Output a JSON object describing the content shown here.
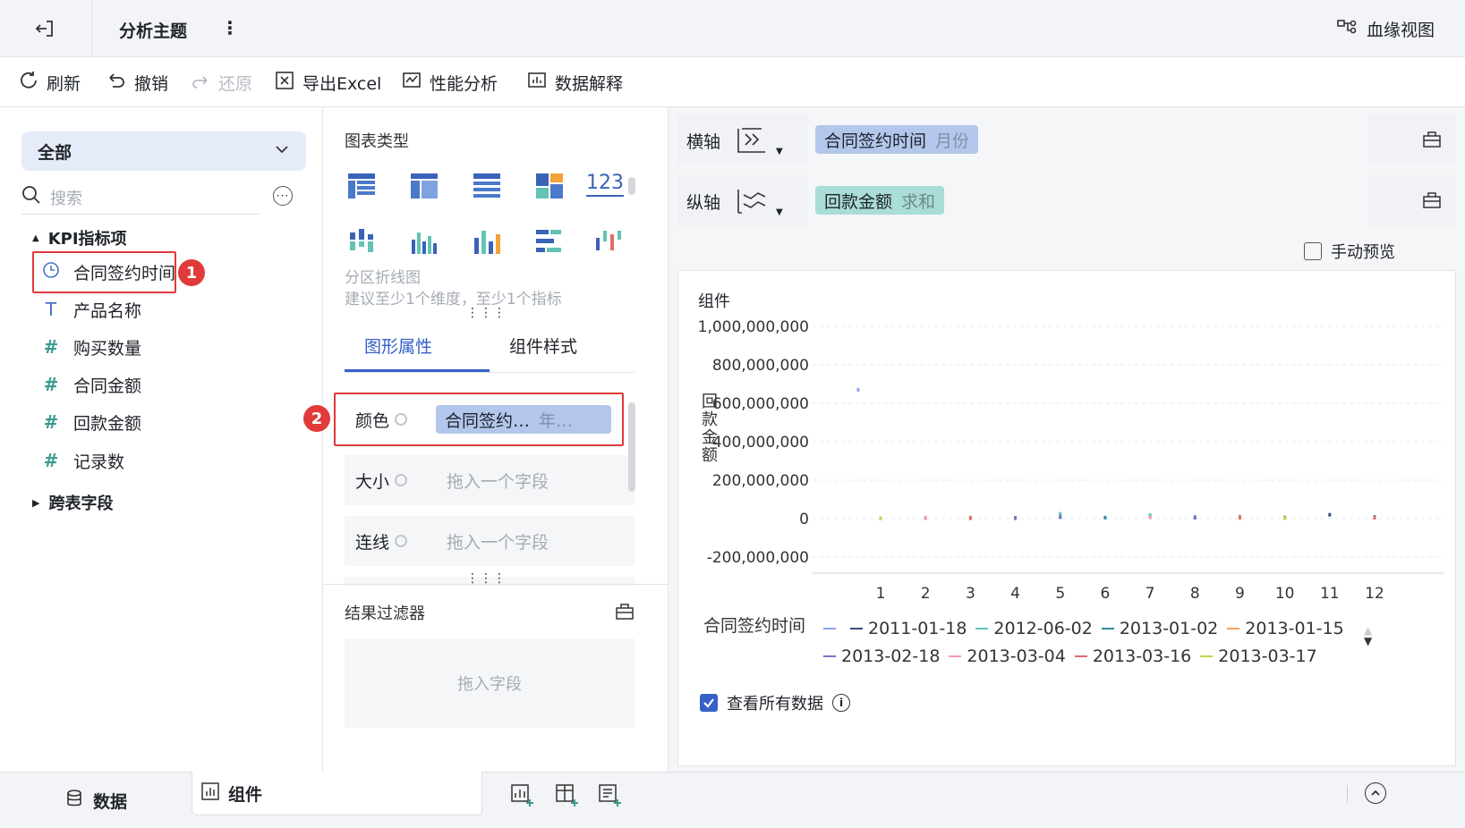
{
  "topbar": {
    "title": "分析主题",
    "more": "⋮",
    "lineage": "血缘视图"
  },
  "toolbar": {
    "refresh": "刷新",
    "undo": "撤销",
    "redo": "还原",
    "export": "导出Excel",
    "perf": "性能分析",
    "explain": "数据解释"
  },
  "left": {
    "dropdown": "全部",
    "search_placeholder": "搜索",
    "group1": "KPI指标项",
    "fields": [
      {
        "label": "合同签约时间",
        "icon": "clock-icon"
      },
      {
        "label": "产品名称",
        "icon": "text-type-icon"
      },
      {
        "label": "购买数量",
        "icon": "hash-icon"
      },
      {
        "label": "合同金额",
        "icon": "hash-icon"
      },
      {
        "label": "回款金额",
        "icon": "hash-icon"
      },
      {
        "label": "记录数",
        "icon": "hash-star-icon"
      }
    ],
    "group2": "跨表字段",
    "badge1": "1"
  },
  "mid": {
    "chart_type_title": "图表类型",
    "hint_title": "分区折线图",
    "hint_desc": "建议至少1个维度，至少1个指标",
    "tab_active": "图形属性",
    "tab_other": "组件样式",
    "badge2": "2",
    "color_label": "颜色",
    "color_chip_main": "合同签约…",
    "color_chip_sub": "年…",
    "size_label": "大小",
    "size_placeholder": "拖入一个字段",
    "line_label": "连线",
    "line_placeholder": "拖入一个字段",
    "filter_title": "结果过滤器",
    "filter_placeholder": "拖入字段",
    "kpi_text": "123"
  },
  "right": {
    "x_label": "横轴",
    "x_chip_main": "合同签约时间",
    "x_chip_sub": "月份",
    "y_label": "纵轴",
    "y_chip_main": "回款金额",
    "y_chip_sub": "求和",
    "manual_preview": "手动预览",
    "card_title": "组件",
    "view_all": "查看所有数据",
    "legend_title": "合同签约时间",
    "colors": {
      "accent": "#3660c8",
      "x_chip": "#b3c7ec",
      "y_chip": "#a9ddd6",
      "red": "#e03a3a"
    }
  },
  "chart_data": {
    "type": "line",
    "title": "",
    "xlabel": "",
    "ylabel": "回款金额",
    "x": [
      1,
      2,
      3,
      4,
      5,
      6,
      7,
      8,
      9,
      10,
      11,
      12
    ],
    "y_ticks": [
      "1,000,000,000",
      "800,000,000",
      "600,000,000",
      "400,000,000",
      "200,000,000",
      "0",
      "-200,000,000"
    ],
    "x_tick_labels": [
      "1",
      "2",
      "3",
      "4",
      "5",
      "6",
      "7",
      "8",
      "9",
      "10",
      "11",
      "12"
    ],
    "ylim": [
      -200000000,
      1000000000
    ],
    "grid": true,
    "legend_position": "bottom",
    "series": [
      {
        "name": "",
        "color": "#8fa6e8",
        "points": [
          [
            0.5,
            670000000
          ]
        ]
      },
      {
        "name": "2011-01-18",
        "color": "#3b4f7a",
        "points": [
          [
            5,
            12000000
          ],
          [
            7,
            15000000
          ],
          [
            11,
            20000000
          ]
        ]
      },
      {
        "name": "2012-06-02",
        "color": "#62c3b5",
        "points": [
          [
            5,
            25000000
          ],
          [
            7,
            18000000
          ],
          [
            9,
            10000000
          ]
        ]
      },
      {
        "name": "2013-01-02",
        "color": "#2c8e9c",
        "points": [
          [
            4,
            4000000
          ],
          [
            6,
            5000000
          ],
          [
            8,
            8000000
          ],
          [
            10,
            6000000
          ],
          [
            12,
            9000000
          ]
        ]
      },
      {
        "name": "2013-01-15",
        "color": "#f4a05a",
        "points": [
          [
            1,
            2000000
          ],
          [
            3,
            6000000
          ],
          [
            9,
            3000000
          ]
        ]
      },
      {
        "name": "2013-02-18",
        "color": "#7a74c8",
        "points": [
          [
            2,
            3000000
          ],
          [
            4,
            2000000
          ],
          [
            5,
            7000000
          ],
          [
            8,
            4000000
          ]
        ]
      },
      {
        "name": "2013-03-04",
        "color": "#f29bb0",
        "points": [
          [
            2,
            5000000
          ],
          [
            7,
            6000000
          ],
          [
            10,
            2000000
          ]
        ]
      },
      {
        "name": "2013-03-16",
        "color": "#e46a6a",
        "points": [
          [
            3,
            2000000
          ],
          [
            9,
            7000000
          ],
          [
            12,
            4000000
          ]
        ]
      },
      {
        "name": "2013-03-17",
        "color": "#c8d34a",
        "points": [
          [
            1,
            1000000
          ],
          [
            10,
            3000000
          ]
        ]
      }
    ]
  }
}
